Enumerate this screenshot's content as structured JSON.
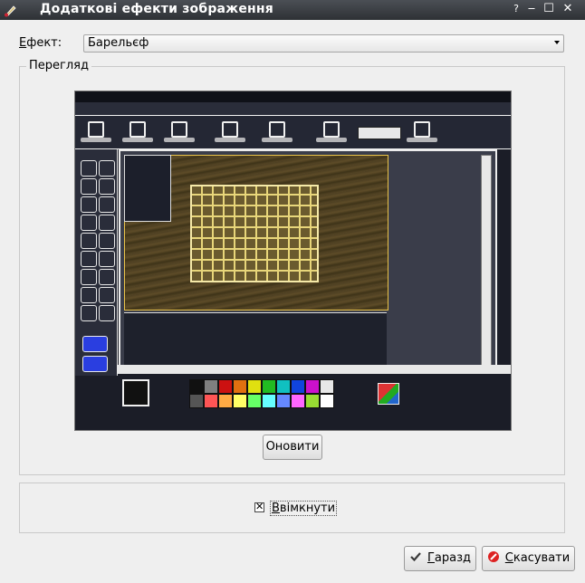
{
  "window": {
    "title": "Додаткові ефекти зображення",
    "buttons": {
      "help": "?",
      "minimize": "‒",
      "maximize": "☐",
      "close": "✕"
    }
  },
  "effect": {
    "label_prefix": "Е",
    "label_rest": "фект:",
    "selected": "Барельєф"
  },
  "preview": {
    "group_label": "Перегляд",
    "refresh_button": "Оновити",
    "thumbnail": {
      "palette_colors": [
        "#111111",
        "#7f7f7f",
        "#cc1111",
        "#e07010",
        "#e0e010",
        "#22bb22",
        "#10c0c0",
        "#1144dd",
        "#cc11cc",
        "#e8e8e8",
        "#555555",
        "#ff5555",
        "#ffaa44",
        "#ffff66",
        "#66ff66",
        "#66ffff",
        "#6688ff",
        "#ff66ff",
        "#99dd33",
        "#ffffff"
      ]
    }
  },
  "enable": {
    "checked_mark": "✕",
    "label_prefix": "В",
    "label_rest": "вімкнути"
  },
  "footer": {
    "ok_prefix": "Г",
    "ok_rest": "аразд",
    "cancel_prefix": "С",
    "cancel_rest": "касувати"
  }
}
